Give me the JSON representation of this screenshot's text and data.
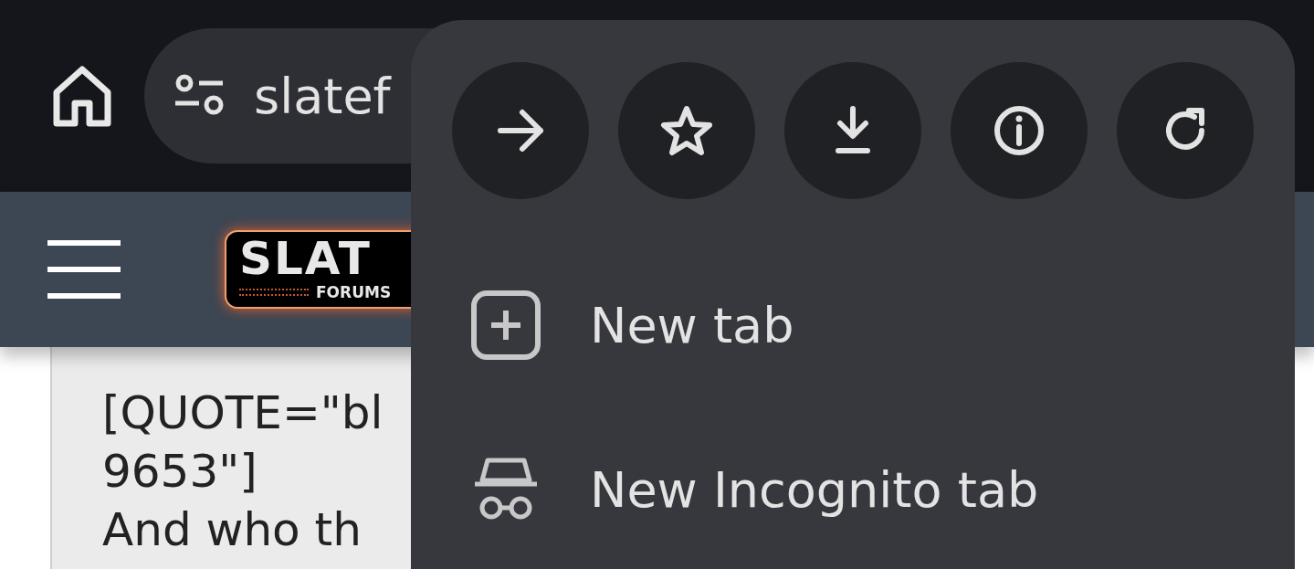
{
  "toolbar": {
    "url": "slatef"
  },
  "site_header": {
    "logo_title": "SLAT",
    "logo_subtitle": "FORUMS"
  },
  "post": {
    "lines": [
      "[QUOTE=\"bl",
      "9653\"]",
      "And who th"
    ]
  },
  "menu": {
    "actions": [
      {
        "kind": "forward"
      },
      {
        "kind": "bookmark"
      },
      {
        "kind": "download"
      },
      {
        "kind": "info"
      },
      {
        "kind": "reload"
      }
    ],
    "items": [
      {
        "kind": "new-tab",
        "label": "New tab"
      },
      {
        "kind": "incognito",
        "label": "New Incognito tab"
      }
    ]
  }
}
